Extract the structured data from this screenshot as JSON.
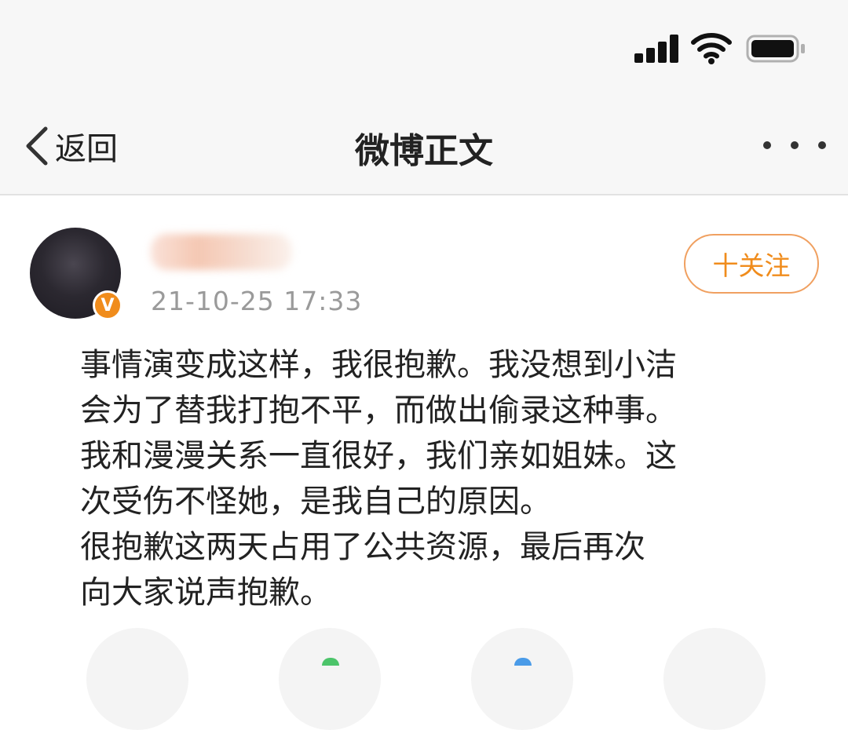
{
  "status_bar": {
    "signal_icon": "cellular-signal-icon",
    "wifi_icon": "wifi-icon",
    "battery_icon": "battery-icon"
  },
  "nav": {
    "back_label": "返回",
    "title": "微博正文",
    "more_icon": "more-dots-icon"
  },
  "post": {
    "author": {
      "avatar": "avatar",
      "verified_badge": "V",
      "name_blurred": true
    },
    "timestamp": "21-10-25 17:33",
    "follow_label": "十关注",
    "content_lines": [
      "事情演变成这样，我很抱歉。我没想到小洁",
      "会为了替我打抱不平，而做出偷录这种事。",
      "我和漫漫关系一直很好，我们亲如姐妹。这",
      "次受伤不怪她，是我自己的原因。",
      "很抱歉这两天占用了公共资源，最后再次",
      "向大家说声抱歉。"
    ]
  },
  "colors": {
    "accent_orange": "#f08c1c",
    "follow_border": "#f0a060",
    "timestamp_gray": "#9a9a9a",
    "header_bg": "#f7f7f7"
  }
}
